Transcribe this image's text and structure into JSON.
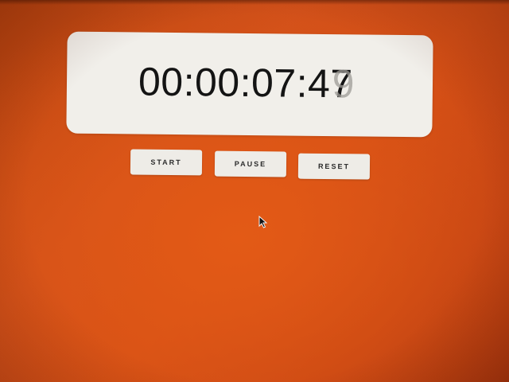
{
  "timer": {
    "display": "00:00:07:47",
    "ghost_digit": "9"
  },
  "controls": {
    "start_label": "START",
    "pause_label": "PAUSE",
    "reset_label": "RESET"
  },
  "colors": {
    "background": "#d44f16",
    "card": "#f1efea",
    "button": "#eeece7",
    "text": "#141414"
  },
  "icons": {
    "pointer": "mouse-pointer-icon"
  }
}
